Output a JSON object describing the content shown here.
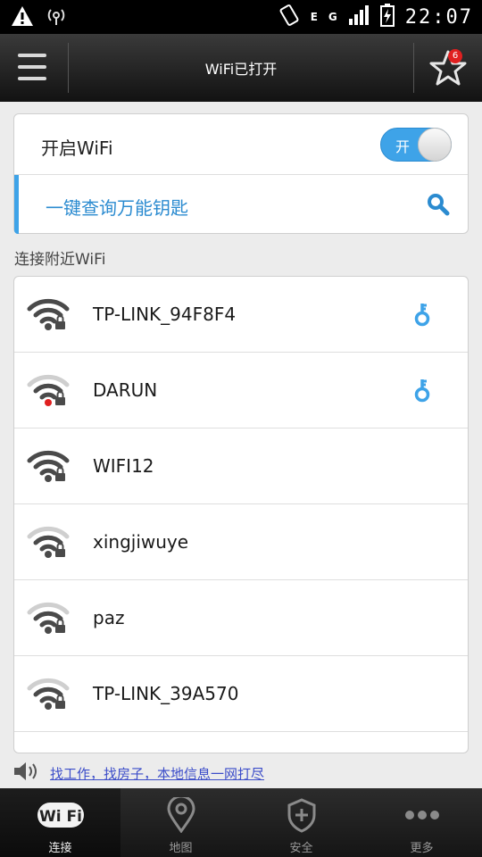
{
  "status": {
    "time": "22:07",
    "network": "E",
    "network2": "G"
  },
  "header": {
    "title": "WiFi已打开",
    "badge_count": "6"
  },
  "wifi_toggle": {
    "label": "开启WiFi",
    "state_label": "开",
    "on": true
  },
  "query": {
    "label": "一键查询万能钥匙"
  },
  "section": {
    "title": "连接附近WiFi"
  },
  "networks": [
    {
      "ssid": "TP-LINK_94F8F4",
      "has_key": true,
      "signal": 3,
      "red_dot": false
    },
    {
      "ssid": "DARUN",
      "has_key": true,
      "signal": 2,
      "red_dot": true
    },
    {
      "ssid": "WIFI12",
      "has_key": false,
      "signal": 3,
      "red_dot": false
    },
    {
      "ssid": "xingjiwuye",
      "has_key": false,
      "signal": 2,
      "red_dot": false
    },
    {
      "ssid": "paz",
      "has_key": false,
      "signal": 2,
      "red_dot": false
    },
    {
      "ssid": "TP-LINK_39A570",
      "has_key": false,
      "signal": 2,
      "red_dot": false
    }
  ],
  "notice": {
    "text": "找工作，找房子，本地信息一网打尽"
  },
  "tabs": [
    {
      "label": "连接",
      "icon": "wifi-icon",
      "active": true
    },
    {
      "label": "地图",
      "icon": "map-pin-icon",
      "active": false
    },
    {
      "label": "安全",
      "icon": "shield-icon",
      "active": false
    },
    {
      "label": "更多",
      "icon": "more-icon",
      "active": false
    }
  ],
  "colors": {
    "accent": "#3ea3e8",
    "link": "#3c4dc9",
    "alert": "#e02020"
  }
}
